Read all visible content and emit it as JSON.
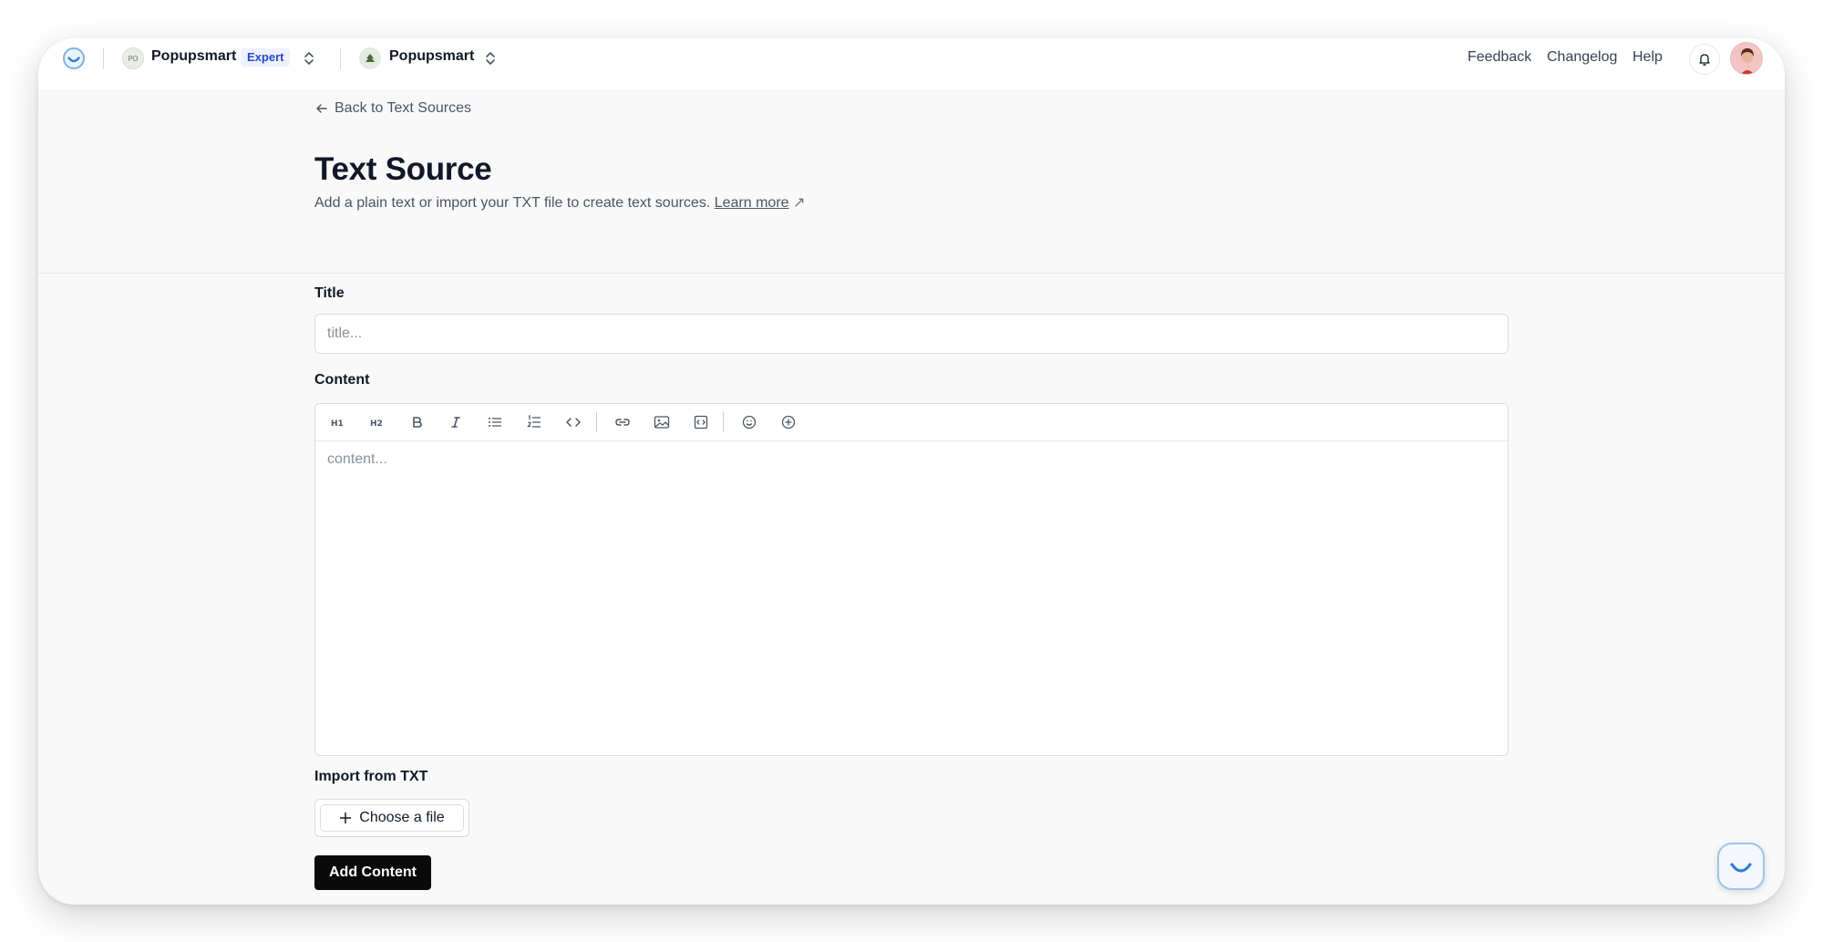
{
  "topbar": {
    "workspace": {
      "initials": "PO",
      "name": "Popupsmart",
      "plan_badge": "Expert"
    },
    "site": {
      "name": "Popupsmart"
    },
    "links": [
      "Feedback",
      "Changelog",
      "Help"
    ],
    "icons": [
      "app-logo-icon",
      "bell-icon",
      "user-avatar"
    ]
  },
  "header": {
    "back_label": "Back to Text Sources",
    "title": "Text Source",
    "subtitle": "Add a plain text or import your TXT file to create text sources.",
    "learn_more": "Learn more",
    "learn_more_icon": "↗"
  },
  "form": {
    "title_label": "Title",
    "title_placeholder": "title...",
    "title_value": "",
    "content_label": "Content",
    "content_placeholder": "content...",
    "toolbar": [
      {
        "name": "heading-1",
        "glyph": "H1"
      },
      {
        "name": "heading-2",
        "glyph": "H2"
      },
      {
        "name": "bold",
        "glyph": "B"
      },
      {
        "name": "italic",
        "glyph": "I"
      },
      {
        "name": "bullet-list",
        "glyph": "list"
      },
      {
        "name": "ordered-list",
        "glyph": "olist"
      },
      {
        "name": "code",
        "glyph": "code"
      },
      {
        "name": "link",
        "glyph": "link"
      },
      {
        "name": "image",
        "glyph": "image"
      },
      {
        "name": "embed",
        "glyph": "embed"
      },
      {
        "name": "emoji",
        "glyph": "emoji"
      },
      {
        "name": "insert",
        "glyph": "plus"
      }
    ],
    "import_label": "Import from TXT",
    "choose_file": "Choose a file",
    "submit": "Add Content"
  },
  "colors": {
    "accent_blue": "#2848c4",
    "primary_button": "#0a0a0a",
    "page_bg": "#f9f9f9"
  }
}
